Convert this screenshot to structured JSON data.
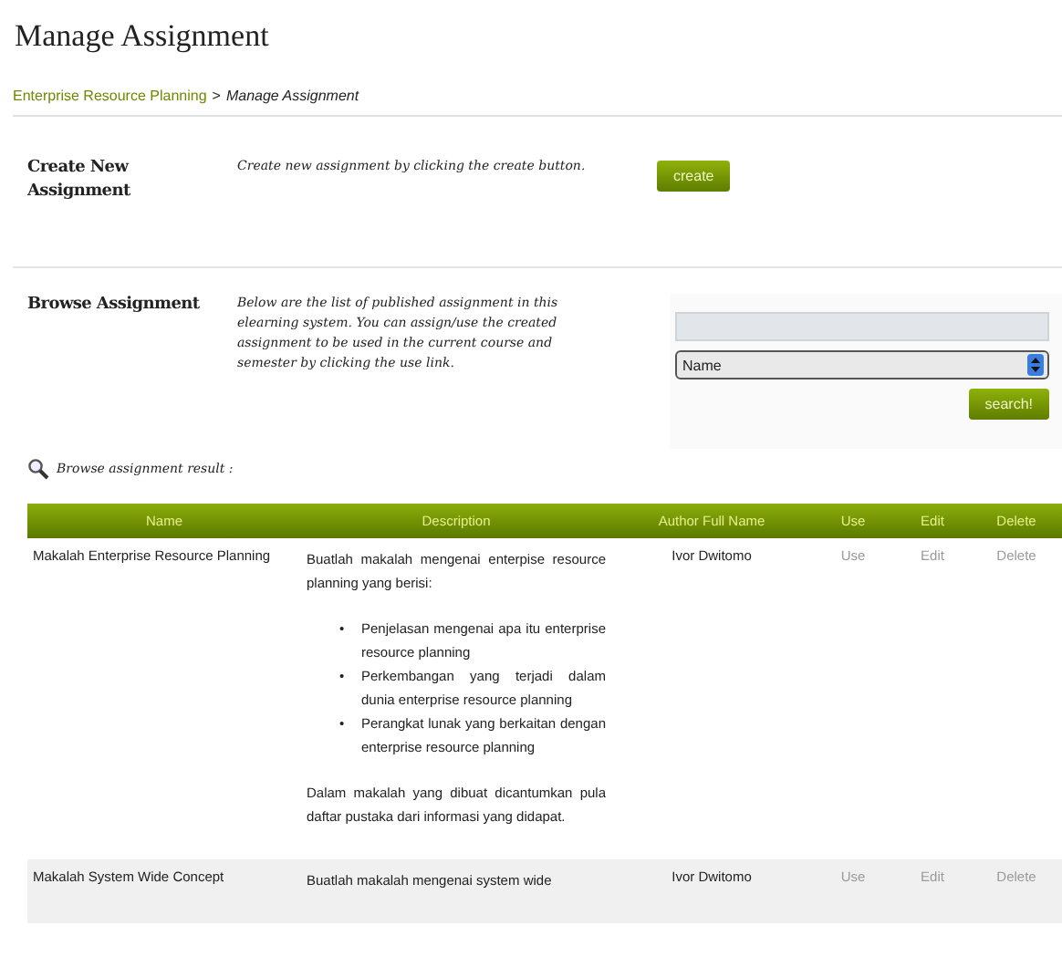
{
  "page_title": "Manage Assignment",
  "breadcrumb": {
    "link": "Enterprise Resource Planning",
    "separator": ">",
    "current": "Manage Assignment"
  },
  "create_section": {
    "heading": "Create New Assignment",
    "description": "Create new assignment by clicking the create button.",
    "button": "create"
  },
  "browse_section": {
    "heading": "Browse Assignment",
    "description": "Below are the list of published assignment in this elearning system. You can assign/use the created assignment to be used in the current course and semester by clicking the use link.",
    "filter_select": {
      "value": "Name"
    },
    "button": "search!"
  },
  "result_label": "Browse assignment result :",
  "table": {
    "columns": [
      "Name",
      "Description",
      "Author Full Name",
      "Use",
      "Edit",
      "Delete"
    ],
    "rows": [
      {
        "name": "Makalah Enterprise Resource Planning",
        "description": {
          "intro": "Buatlah makalah mengenai enterpise resource planning yang berisi:",
          "bullets": [
            {
              "marker": "•",
              "text": "Penjelasan mengenai apa itu enterprise resource planning"
            },
            {
              "marker": "•",
              "text": "Perkembangan yang terjadi dalam dunia enterprise resource planning"
            },
            {
              "marker": "•",
              "text": "Perangkat lunak yang berkaitan dengan enterprise resource planning"
            }
          ],
          "outro": "Dalam makalah yang dibuat dicantumkan pula daftar pustaka dari informasi yang didapat."
        },
        "author": "Ivor Dwitomo",
        "use": "Use",
        "edit": "Edit",
        "delete": "Delete"
      },
      {
        "name": "Makalah System Wide Concept",
        "description": {
          "intro": "Buatlah makalah mengenai system wide"
        },
        "author": "Ivor Dwitomo",
        "use": "Use",
        "edit": "Edit",
        "delete": "Delete"
      }
    ]
  }
}
